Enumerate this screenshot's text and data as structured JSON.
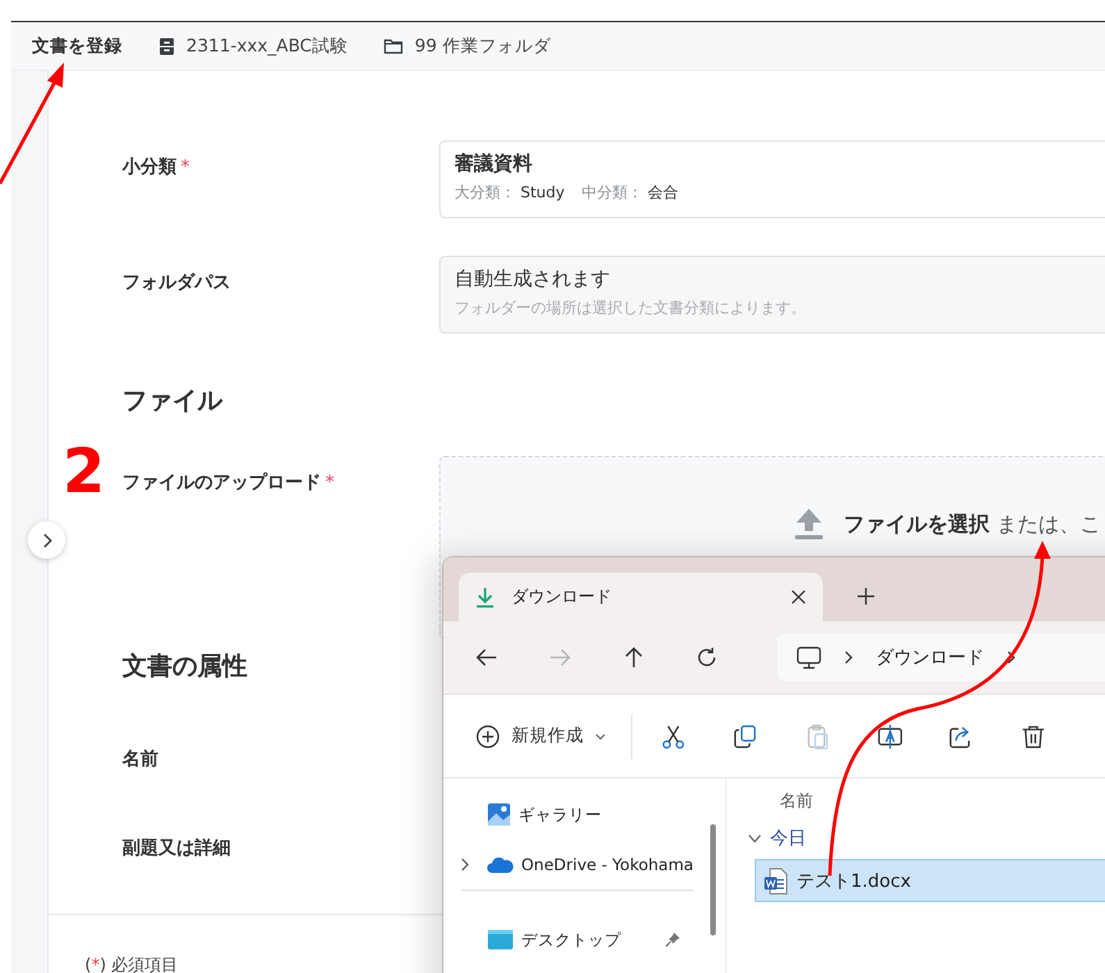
{
  "breadcrumb": [
    {
      "kind": "title",
      "label": "文書を登録"
    },
    {
      "kind": "cabinet",
      "label": "2311-xxx_ABC試験"
    },
    {
      "kind": "folder",
      "label": "99 作業フォルダ"
    }
  ],
  "required_mark": "*",
  "form": [
    {
      "kind": "select",
      "label": "小分類",
      "required": true,
      "value": "審議資料",
      "meta": [
        {
          "key": "大分類：",
          "value": "Study"
        },
        {
          "key": "中分類：",
          "value": "会合"
        }
      ]
    },
    {
      "kind": "readonly",
      "label": "フォルダパス",
      "required": false,
      "value": "自動生成されます",
      "hint": "フォルダーの場所は選択した文書分類によります。"
    },
    {
      "kind": "heading",
      "label": "ファイル"
    },
    {
      "kind": "upload",
      "label": "ファイルのアップロード",
      "required": true,
      "action": "ファイルを選択",
      "rest": "または、こ"
    },
    {
      "kind": "heading",
      "label": "文書の属性"
    },
    {
      "kind": "text",
      "label": "名前",
      "required": false
    },
    {
      "kind": "text",
      "label": "副題又は詳細",
      "required": false
    }
  ],
  "footer": {
    "prefix": "(",
    "mark": "*",
    "suffix": ") 必須項目"
  },
  "annotation": {
    "step": "2"
  },
  "explorer": {
    "tab": {
      "title": "ダウンロード"
    },
    "nav": [
      {
        "kind": "back",
        "disabled": false
      },
      {
        "kind": "forward",
        "disabled": true
      },
      {
        "kind": "up",
        "disabled": false
      },
      {
        "kind": "refresh",
        "disabled": false
      }
    ],
    "address": [
      "ダウンロード"
    ],
    "toolbar": [
      {
        "kind": "new",
        "label": "新規作成"
      },
      {
        "kind": "cut",
        "disabled": false
      },
      {
        "kind": "copy",
        "disabled": false
      },
      {
        "kind": "paste",
        "disabled": true
      },
      {
        "kind": "rename",
        "disabled": false
      },
      {
        "kind": "share",
        "disabled": false
      },
      {
        "kind": "delete",
        "disabled": false
      }
    ],
    "nav_pane": [
      {
        "kind": "gallery",
        "label": "ギャラリー",
        "expandable": false,
        "pinned": false
      },
      {
        "kind": "cloud",
        "label": "OneDrive - Yokohama",
        "expandable": true,
        "pinned": false
      },
      {
        "kind": "separator"
      },
      {
        "kind": "desktop",
        "label": "デスクトップ",
        "expandable": false,
        "pinned": true
      }
    ],
    "column": "名前",
    "groups": [
      {
        "label": "今日",
        "expanded": true,
        "files": [
          {
            "name": "テスト1.docx",
            "selected": true
          }
        ]
      }
    ]
  }
}
